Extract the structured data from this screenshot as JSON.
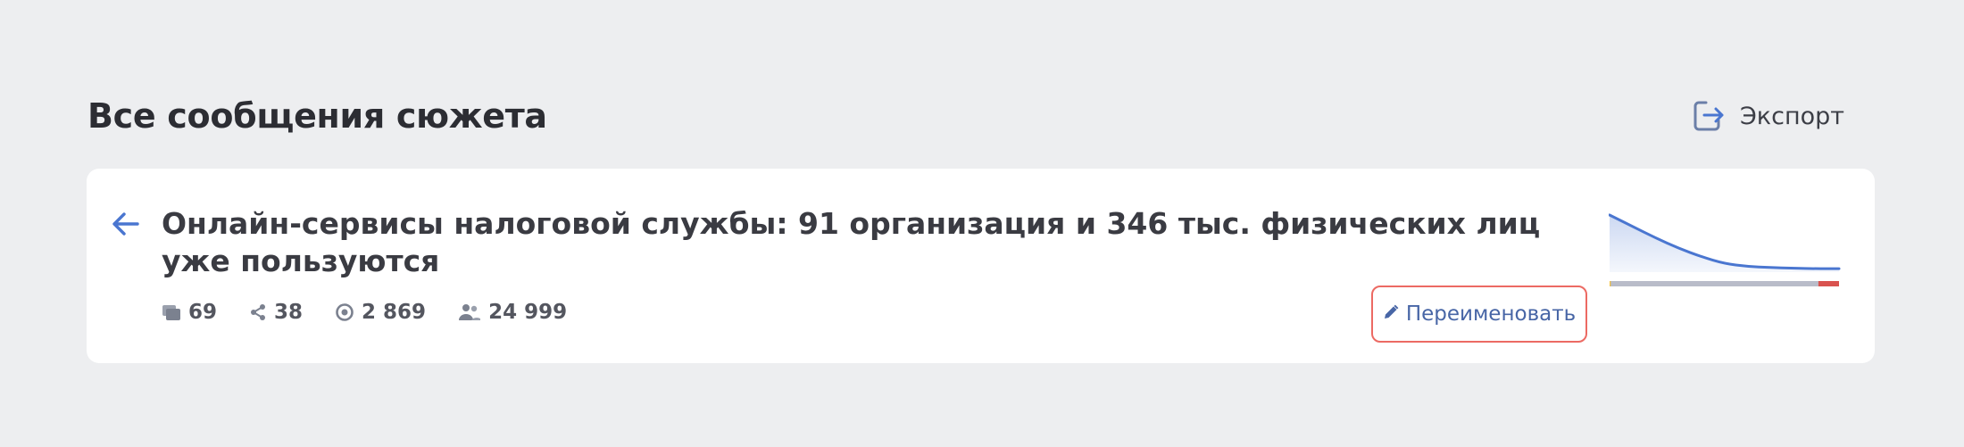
{
  "page": {
    "title": "Все сообщения сюжета",
    "export_label": "Экспорт"
  },
  "story": {
    "title": "Онлайн-сервисы налоговой службы: 91 организация и 346 тыс. физических лиц уже пользуются",
    "stats": {
      "messages": "69",
      "reposts": "38",
      "views": "2 869",
      "audience": "24 999"
    },
    "rename_label": "Переименовать"
  },
  "colors": {
    "accent_blue": "#4a76d0",
    "rename_border": "#ec6a63",
    "sentiment_negative": "#d9534f",
    "sentiment_neutral": "#b9bcc9",
    "sentiment_positive": "#f0c040"
  },
  "chart_data": {
    "type": "area",
    "x": [
      0,
      1,
      2,
      3,
      4,
      5,
      6,
      7,
      8,
      9,
      10
    ],
    "values": [
      100,
      80,
      60,
      42,
      27,
      15,
      10,
      8,
      7,
      6,
      6
    ],
    "ylim": [
      0,
      100
    ],
    "sentiment_bar": [
      {
        "name": "positive",
        "value": 0.5,
        "color": "#f0c040"
      },
      {
        "name": "neutral",
        "value": 90.5,
        "color": "#b9bcc9"
      },
      {
        "name": "negative",
        "value": 9,
        "color": "#d9534f"
      }
    ]
  }
}
